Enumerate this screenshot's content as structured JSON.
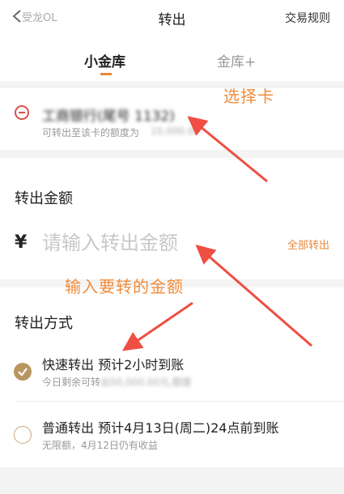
{
  "nav": {
    "back_label": "受龙OL",
    "title": "转出",
    "rules": "交易规则"
  },
  "tabs": [
    {
      "label": "小金库",
      "active": true
    },
    {
      "label": "金库+",
      "active": false
    }
  ],
  "card_select": {
    "bank_name": "工商银行(尾号 1132)",
    "sub_prefix": "可转出至该卡的额度为",
    "sub_amount": "10,000.00",
    "annotation": "选择卡"
  },
  "amount": {
    "section_title": "转出金额",
    "currency": "¥",
    "placeholder": "请输入转出金额",
    "all_out": "全部转出",
    "annotation": "输入要转的金额"
  },
  "method": {
    "section_title": "转出方式",
    "options": [
      {
        "title": "快速转出 预计2小时到账",
        "sub_prefix": "今日剩余可转",
        "sub_blur": "出50,000.00元,额度",
        "selected": true
      },
      {
        "title": "普通转出 预计4月13日(周二)24点前到账",
        "sub_prefix": "无限额，4月12日仍有收益",
        "selected": false
      }
    ]
  },
  "colors": {
    "accent": "#e5883a",
    "annotation": "#f28c3a",
    "arrow": "#ef4e43",
    "radio_checked": "#b89661",
    "radio_red": "#d9534f"
  },
  "icons": {
    "back": "chevron-left-icon",
    "check": "check-icon"
  }
}
